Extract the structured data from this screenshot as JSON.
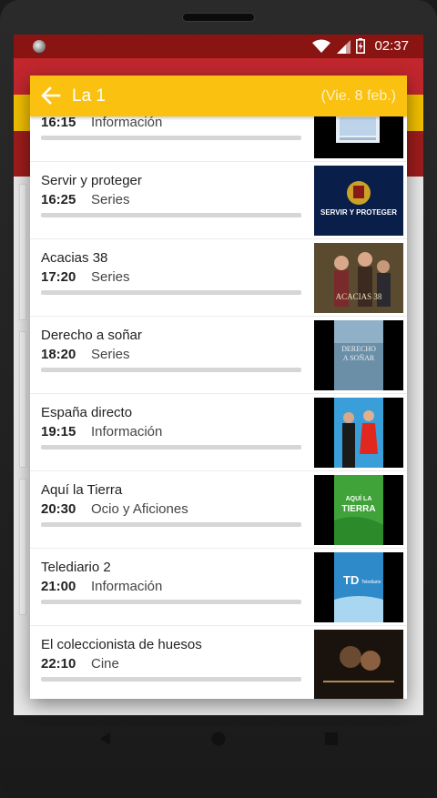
{
  "status_bar": {
    "time": "02:37",
    "icons": [
      "wifi-icon",
      "signal-icon",
      "battery-charging-icon"
    ]
  },
  "dialog": {
    "title": "La 1",
    "date": "(Vie. 8 feb.)"
  },
  "programs": [
    {
      "title": "",
      "time": "16:15",
      "genre": "Información",
      "progress": 0,
      "thumb": "thumbnail-informacion"
    },
    {
      "title": "Servir y proteger",
      "time": "16:25",
      "genre": "Series",
      "progress": 0,
      "thumb": "thumbnail-servir-y-proteger"
    },
    {
      "title": "Acacias 38",
      "time": "17:20",
      "genre": "Series",
      "progress": 0,
      "thumb": "thumbnail-acacias-38"
    },
    {
      "title": "Derecho a soñar",
      "time": "18:20",
      "genre": "Series",
      "progress": 0,
      "thumb": "thumbnail-derecho-a-sonar"
    },
    {
      "title": "España directo",
      "time": "19:15",
      "genre": "Información",
      "progress": 0,
      "thumb": "thumbnail-espana-directo"
    },
    {
      "title": "Aquí la Tierra",
      "time": "20:30",
      "genre": "Ocio y Aficiones",
      "progress": 0,
      "thumb": "thumbnail-aqui-la-tierra"
    },
    {
      "title": "Telediario 2",
      "time": "21:00",
      "genre": "Información",
      "progress": 0,
      "thumb": "thumbnail-telediario-2"
    },
    {
      "title": "El coleccionista de huesos",
      "time": "22:10",
      "genre": "Cine",
      "progress": 0,
      "thumb": "thumbnail-el-coleccionista-de-huesos"
    }
  ],
  "thumb_text": {
    "servir": "SERVIR Y PROTEGER",
    "acacias": "ACACIAS 38",
    "derecho_1": "DERECHO",
    "derecho_2": "A SOÑAR",
    "tierra_1": "AQUÍ LA",
    "tierra_2": "TIERRA",
    "td": "TD",
    "td_sub": "Telediario"
  },
  "nav": {
    "buttons": [
      "back-triangle-icon",
      "home-circle-icon",
      "recents-square-icon"
    ]
  },
  "colors": {
    "flag_red": "#c1272d",
    "flag_yellow": "#f1bf00",
    "dialog_header": "#fbc111"
  }
}
